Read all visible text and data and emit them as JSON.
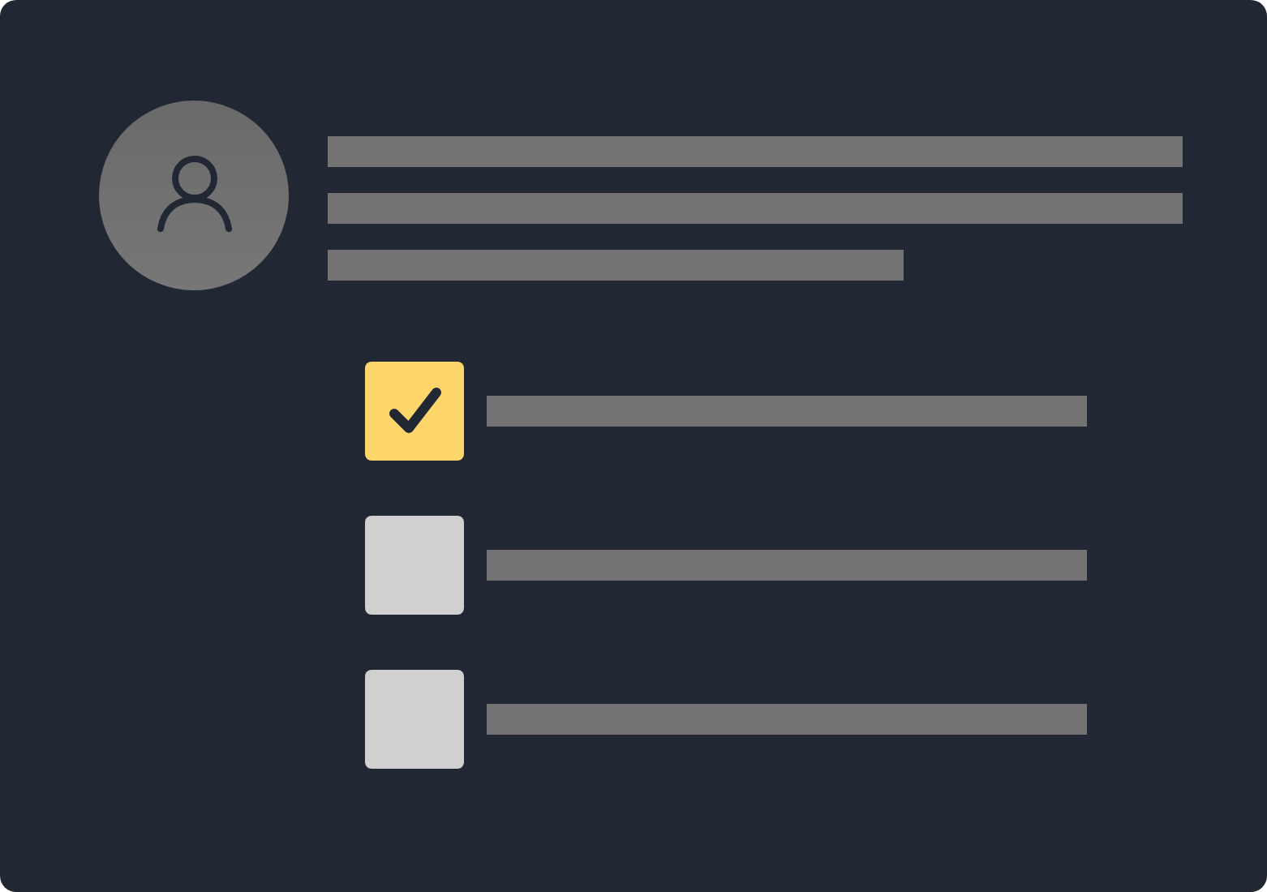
{
  "items": [
    {
      "checked": true
    },
    {
      "checked": false
    },
    {
      "checked": false
    }
  ]
}
